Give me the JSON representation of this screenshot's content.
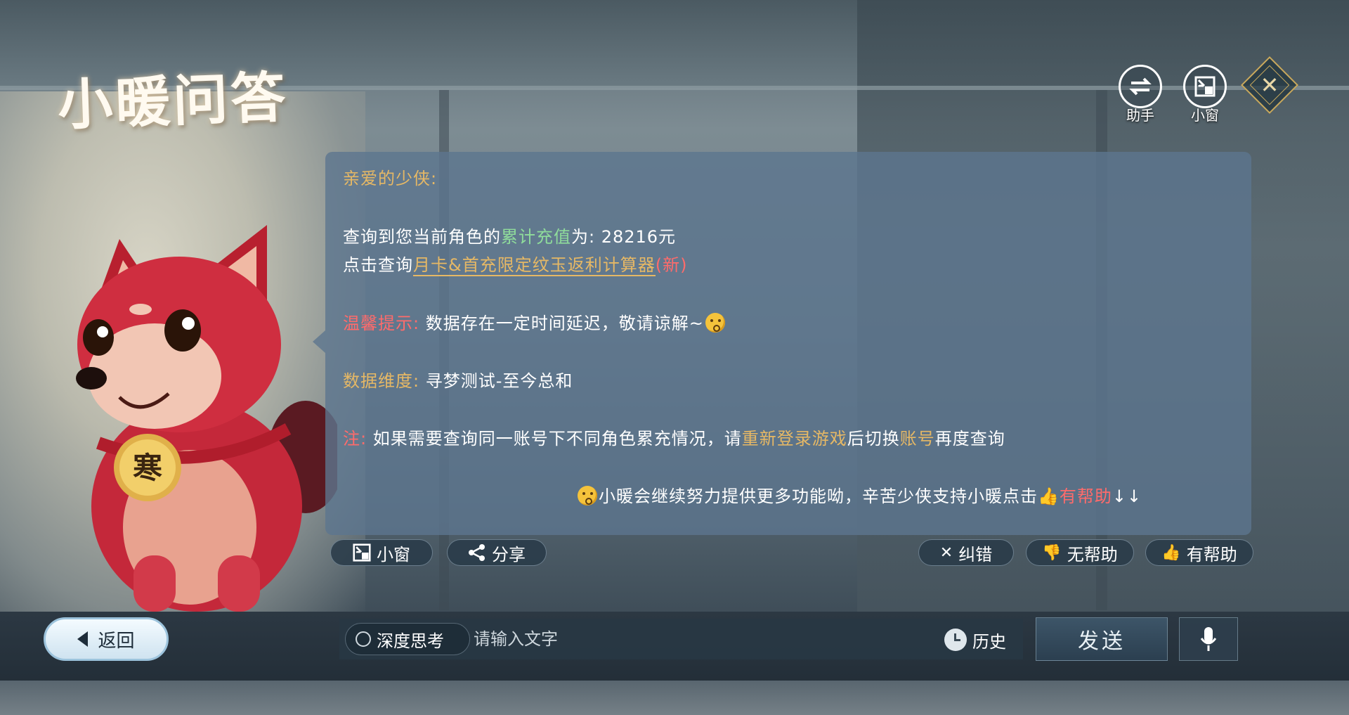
{
  "title": "小暖问答",
  "top_buttons": {
    "assistant_label": "助手",
    "mini_window_label": "小窗"
  },
  "message": {
    "greeting": "亲爱的少侠:",
    "query_prefix": "查询到您当前角色的",
    "query_highlight": "累计充值",
    "query_suffix": "为: 28216元",
    "calc_prefix": "点击查询",
    "calc_link": "月卡&首充限定纹玉返利计算器",
    "calc_new": "(新)",
    "tip_label": "温馨提示:",
    "tip_text": "数据存在一定时间延迟，敬请谅解~",
    "dimension_label": "数据维度:",
    "dimension_text": "寻梦测试-至今总和",
    "note_label": "注:",
    "note_text_1": "如果需要查询同一账号下不同角色累充情况，请",
    "note_highlight_1": "重新登录游戏",
    "note_text_2": "后切换",
    "note_highlight_2": "账号",
    "note_text_3": "再度查询",
    "footer_text": "小暖会继续努力提供更多功能呦，辛苦少侠支持小暖点击",
    "footer_link": "有帮助",
    "footer_arrows": "↓↓"
  },
  "actions": {
    "mini_window": "小窗",
    "share": "分享",
    "correct": "纠错",
    "not_helpful": "无帮助",
    "helpful": "有帮助"
  },
  "bottom": {
    "back": "返回",
    "deep_think": "深度思考",
    "input_placeholder": "请输入文字",
    "history": "历史",
    "send": "发送"
  },
  "collar_char": "寒",
  "colors": {
    "gold": "#e6b865",
    "green": "#8fdc9b",
    "red": "#ff6b6b",
    "panel": "#5c768e"
  }
}
